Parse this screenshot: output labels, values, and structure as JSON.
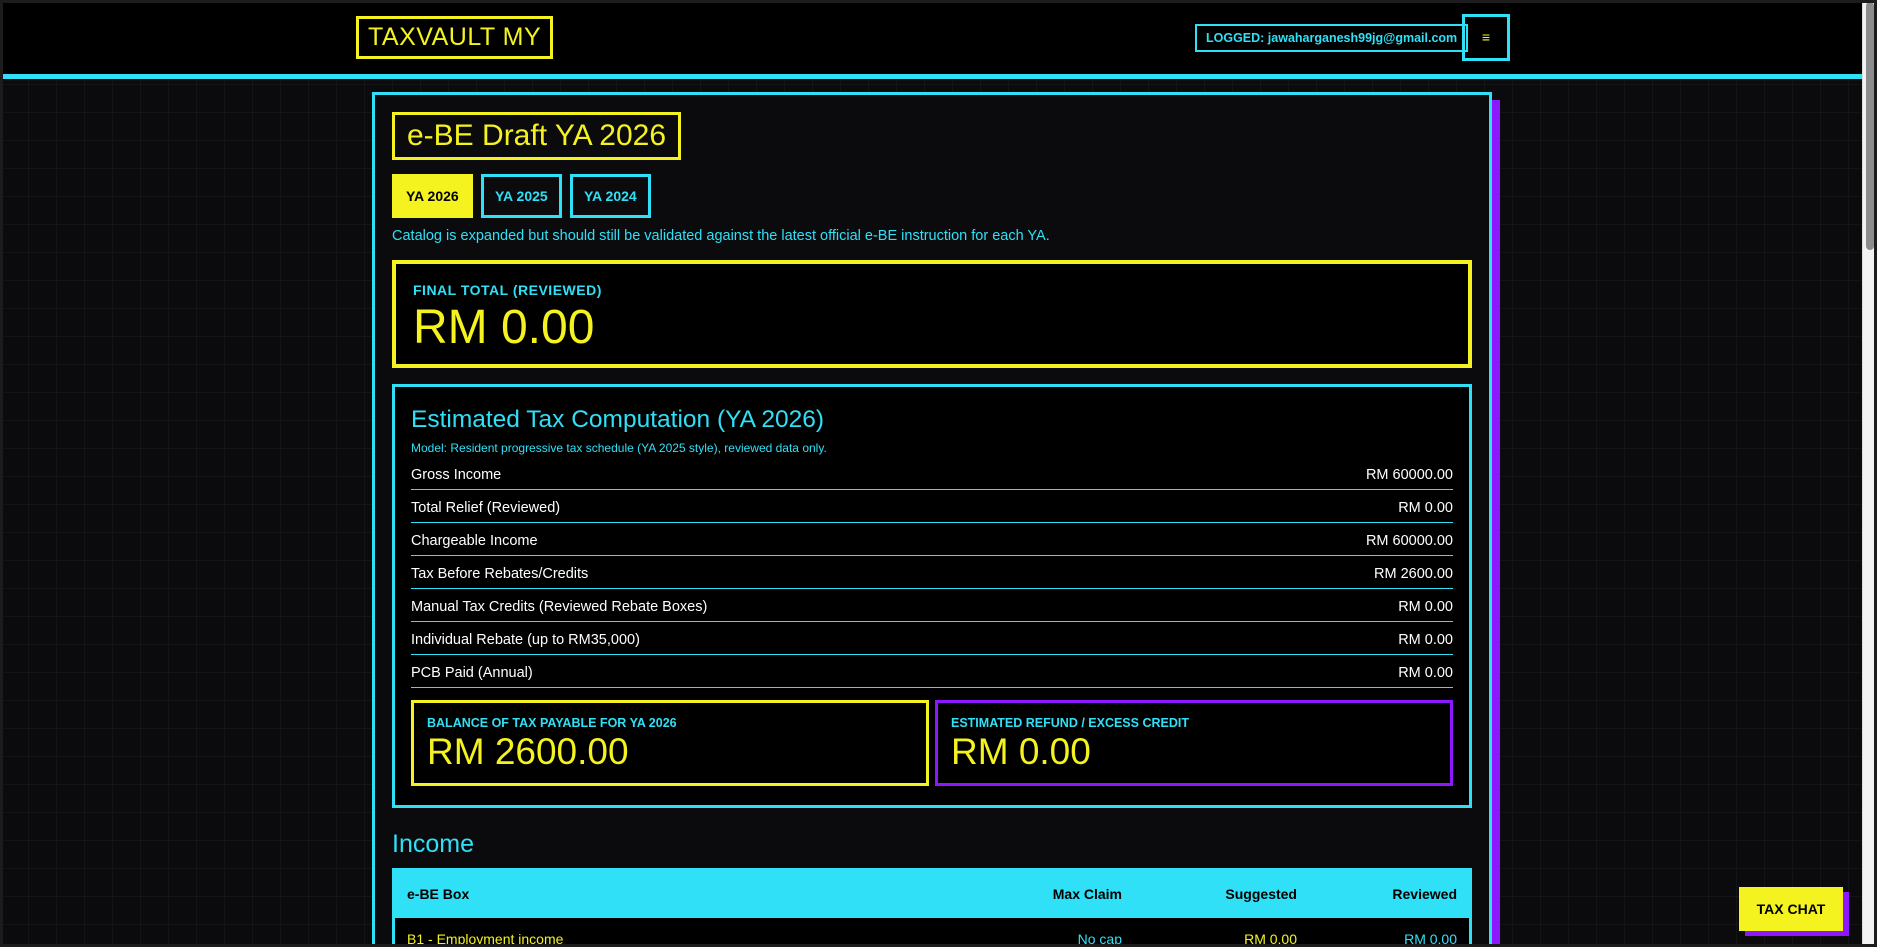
{
  "header": {
    "logo": "TAXVAULT MY",
    "logged_in": "LOGGED: jawaharganesh99jg@gmail.com",
    "menu_label": "≡"
  },
  "page": {
    "title": "e-BE Draft YA 2026",
    "tabs": [
      {
        "label": "YA 2026",
        "active": true
      },
      {
        "label": "YA 2025",
        "active": false
      },
      {
        "label": "YA 2024",
        "active": false
      }
    ],
    "catalog_note": "Catalog is expanded but should still be validated against the latest official e-BE instruction for each YA."
  },
  "final_total": {
    "label": "FINAL TOTAL (REVIEWED)",
    "value": "RM 0.00"
  },
  "computation": {
    "title": "Estimated Tax Computation (YA 2026)",
    "model": "Model: Resident progressive tax schedule (YA 2025 style), reviewed data only.",
    "rows": [
      {
        "label": "Gross Income",
        "value": "RM 60000.00"
      },
      {
        "label": "Total Relief (Reviewed)",
        "value": "RM 0.00"
      },
      {
        "label": "Chargeable Income",
        "value": "RM 60000.00"
      },
      {
        "label": "Tax Before Rebates/Credits",
        "value": "RM 2600.00"
      },
      {
        "label": "Manual Tax Credits (Reviewed Rebate Boxes)",
        "value": "RM 0.00"
      },
      {
        "label": "Individual Rebate (up to RM35,000)",
        "value": "RM 0.00"
      },
      {
        "label": "PCB Paid (Annual)",
        "value": "RM 0.00"
      }
    ],
    "balance": {
      "label": "BALANCE OF TAX PAYABLE FOR YA 2026",
      "value": "RM 2600.00"
    },
    "refund": {
      "label": "ESTIMATED REFUND / EXCESS CREDIT",
      "value": "RM 0.00"
    }
  },
  "income": {
    "heading": "Income",
    "columns": [
      "e-BE Box",
      "Max Claim",
      "Suggested",
      "Reviewed"
    ],
    "rows": [
      {
        "box": "B1 - Employment income",
        "max_claim": "No cap",
        "suggested": "RM 0.00",
        "reviewed": "RM 0.00"
      }
    ]
  },
  "chat": {
    "label": "TAX CHAT"
  },
  "colors": {
    "accent_cyan": "#2fe0f7",
    "accent_yellow": "#f4f31f",
    "accent_purple": "#8d18ff"
  }
}
